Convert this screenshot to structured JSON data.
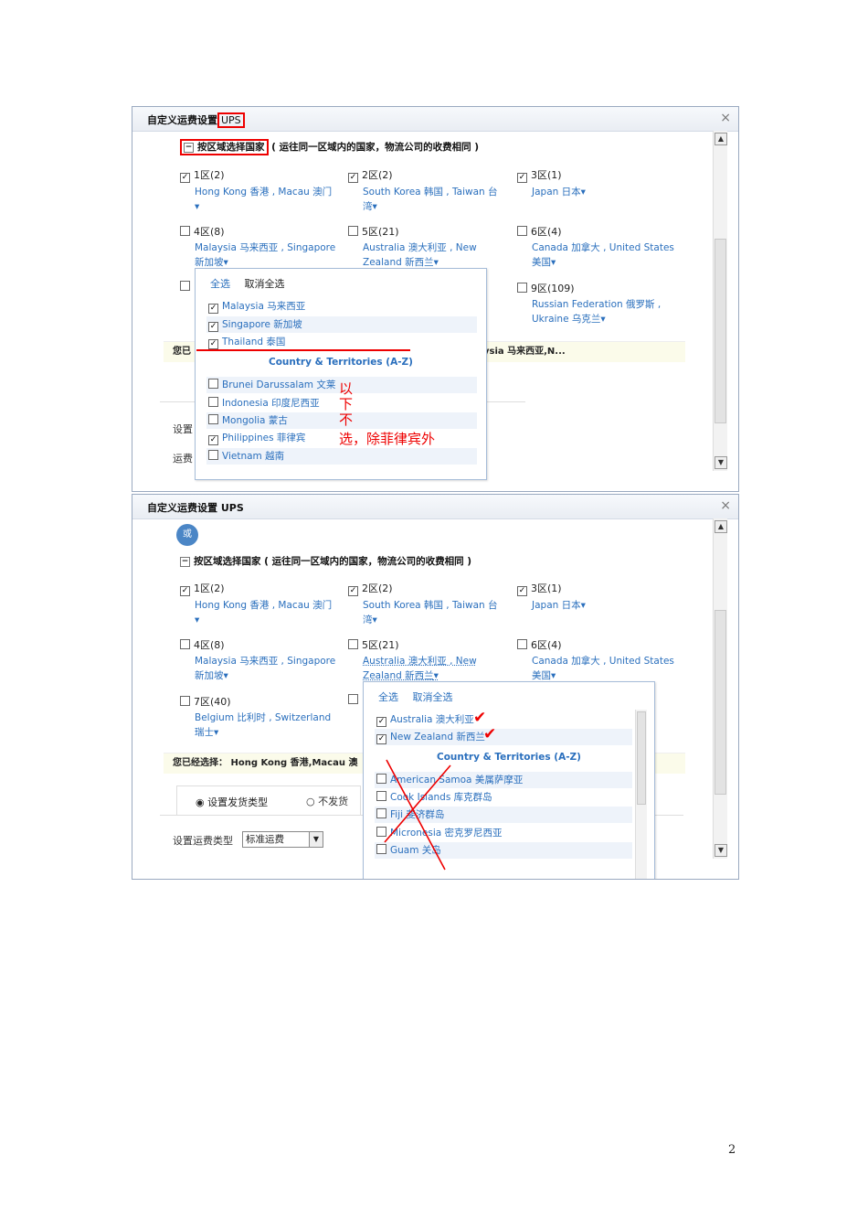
{
  "shot1": {
    "title_prefix": "自定义运费设置",
    "title_carrier": "UPS",
    "close": "×",
    "group_label": "按区域选择国家",
    "group_note": "( 运往同一区域内的国家，物流公司的收费相同 )",
    "zones": [
      {
        "label": "1区",
        "count": "(2)",
        "checked": true,
        "countries": "Hong Kong 香港 , Macau 澳门"
      },
      {
        "label": "2区",
        "count": "(2)",
        "checked": true,
        "countries": "South Korea 韩国 , Taiwan 台湾"
      },
      {
        "label": "3区",
        "count": "(1)",
        "checked": true,
        "countries": "Japan 日本"
      },
      {
        "label": "4区",
        "count": "(8)",
        "checked": false,
        "countries": "Malaysia 马来西亚 , Singapore 新加坡"
      },
      {
        "label": "5区",
        "count": "(21)",
        "checked": false,
        "countries": "Australia 澳大利亚 , New Zealand 新西兰"
      },
      {
        "label": "6区",
        "count": "(4)",
        "checked": false,
        "countries": "Canada 加拿大 , United States 美国"
      },
      {
        "label": "9区",
        "count": "(109)",
        "checked": false,
        "countries": "Russian Federation 俄罗斯 , Ukraine 乌克兰"
      }
    ],
    "popup": {
      "select_all": "全选",
      "deselect_all": "取消全选",
      "selected": [
        "Malaysia 马来西亚",
        "Singapore 新加坡",
        "Thailand 泰国"
      ],
      "section_title": "Country & Territories (A-Z)",
      "list": [
        {
          "name": "Brunei Darussalam 文莱",
          "checked": false
        },
        {
          "name": "Indonesia 印度尼西亚",
          "checked": false
        },
        {
          "name": "Mongolia 蒙古",
          "checked": false
        },
        {
          "name": "Philippines 菲律宾",
          "checked": true
        },
        {
          "name": "Vietnam 越南",
          "checked": false
        }
      ]
    },
    "summary_prefix": "您已",
    "summary_suffix": "ysia 马来西亚,N...",
    "side_label_1": "设置",
    "side_label_2": "运费",
    "annotation_vertical": [
      "以",
      "下",
      "不"
    ],
    "annotation_line": "选，除菲律宾外"
  },
  "shot2": {
    "title": "自定义运费设置 UPS",
    "close": "×",
    "or_badge": "或",
    "group_label": "按区域选择国家",
    "group_note": "( 运往同一区域内的国家，物流公司的收费相同 )",
    "zones": [
      {
        "label": "1区",
        "count": "(2)",
        "checked": true,
        "countries": "Hong Kong 香港 , Macau 澳门"
      },
      {
        "label": "2区",
        "count": "(2)",
        "checked": true,
        "countries": "South Korea 韩国 , Taiwan 台湾"
      },
      {
        "label": "3区",
        "count": "(1)",
        "checked": true,
        "countries": "Japan 日本"
      },
      {
        "label": "4区",
        "count": "(8)",
        "checked": false,
        "countries": "Malaysia 马来西亚 , Singapore 新加坡"
      },
      {
        "label": "5区",
        "count": "(21)",
        "checked": false,
        "countries": "Australia 澳大利亚 , New Zealand 新西兰"
      },
      {
        "label": "6区",
        "count": "(4)",
        "checked": false,
        "countries": "Canada 加拿大 , United States 美国"
      },
      {
        "label": "7区",
        "count": "(40)",
        "checked": false,
        "countries": "Belgium 比利时 , Switzerland 瑞士"
      }
    ],
    "popup": {
      "select_all": "全选",
      "deselect_all": "取消全选",
      "selected": [
        "Australia 澳大利亚",
        "New Zealand 新西兰"
      ],
      "section_title": "Country & Territories (A-Z)",
      "list": [
        {
          "name": "American Samoa 美属萨摩亚",
          "checked": false
        },
        {
          "name": "Cook Islands 库克群岛",
          "checked": false
        },
        {
          "name": "Fiji 斐济群岛",
          "checked": false
        },
        {
          "name": "Micronesia 密克罗尼西亚",
          "checked": false
        },
        {
          "name": "Guam 关岛",
          "checked": false
        }
      ]
    },
    "summary": "您已经选择： Hong Kong 香港,Macau 澳",
    "radio_ship": "设置发货类型",
    "radio_noship": "不发货",
    "freight_type_label": "设置运费类型",
    "freight_type_value": "标准运费"
  },
  "page_number": "2",
  "icons": {
    "close": "close-icon",
    "dropdown": "chevron-down-icon",
    "checkmark": "checkmark-icon"
  },
  "colors": {
    "link": "#2a6fbd",
    "annotation": "#e00000"
  }
}
